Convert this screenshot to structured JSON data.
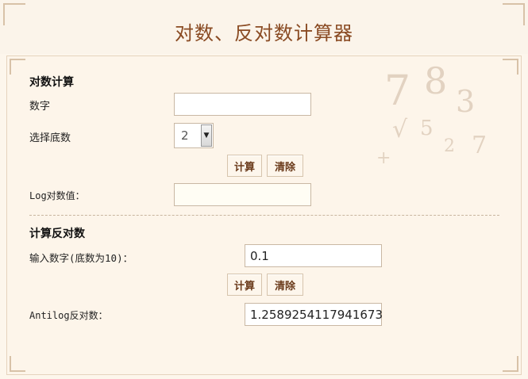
{
  "page": {
    "title": "对数、反对数计算器"
  },
  "log_section": {
    "title": "对数计算",
    "number_label": "数字",
    "number_value": "",
    "base_label": "选择底数",
    "base_value": "2",
    "calc_label": "计算",
    "clear_label": "清除",
    "result_label": "Log对数值：",
    "result_value": ""
  },
  "antilog_section": {
    "title": "计算反对数",
    "input_label": "输入数字(底数为10)：",
    "input_value": "0.1",
    "calc_label": "计算",
    "clear_label": "清除",
    "result_label": "Antilog反对数：",
    "result_value": "1.2589254117941673"
  },
  "icons": {
    "dropdown": "chevron-down-icon"
  },
  "colors": {
    "title": "#8a4b23",
    "button_text": "#6a3a1a",
    "background": "#fdf6ec"
  }
}
